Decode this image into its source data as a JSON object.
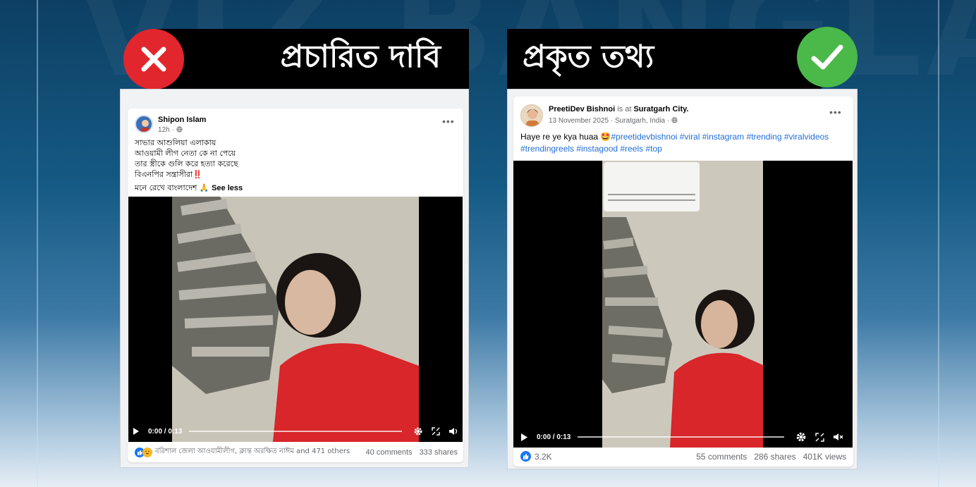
{
  "banner": {
    "claim_title": "প্রচারিত দাবি",
    "fact_title": "প্রকৃত তথ্য"
  },
  "claim_post": {
    "author": "Shipon Islam",
    "meta": "12h · ",
    "caption_lines": [
      "সাভার আশুলিয়া এলাকায়",
      "আওয়ামী লীগ নেতা কে না পেয়ে",
      "তার স্ত্রীকে গুলি করে হত্যা করেছে",
      "বিএনপির সন্ত্রাসীরা‼️",
      "মনে রেখে বাংলাদেশ 🙏"
    ],
    "see_less": "See less",
    "video_time": "0:00 / 0:13",
    "reactions_text": "বরিশাল জেলা আওয়ামীলীগ, ক্লান্ত অরক্ষিত নাঈম and 471 others",
    "comments": "40 comments",
    "shares": "333 shares",
    "icons": [
      "globe-icon",
      "play-icon",
      "settings-icon",
      "fullscreen-icon",
      "volume-icon",
      "like-icon",
      "haha-icon"
    ]
  },
  "fact_post": {
    "author": "PreetiDev Bishnoi",
    "is_at": " is at ",
    "place": "Suratgarh City.",
    "meta": "13 November 2025 · Suratgarh, India · ",
    "caption_prefix": "Haye re ye kya huaa 🤩",
    "hashtags_line1": "#preetidevbishnoi #viral #instagram #trending #viralvideos",
    "hashtags_line2": "#trendingreels #instagood #reels #top",
    "video_time": "0:00 / 0:13",
    "likes": "3.2K",
    "comments": "55 comments",
    "shares": "286 shares",
    "views": "401K views",
    "icons": [
      "globe-icon",
      "play-icon",
      "settings-icon",
      "fullscreen-icon",
      "mute-icon",
      "like-icon"
    ]
  },
  "colors": {
    "false_badge": "#e2262d",
    "true_badge": "#4bb84a",
    "banner_bg": "#000000",
    "hashtag": "#216fdb"
  }
}
